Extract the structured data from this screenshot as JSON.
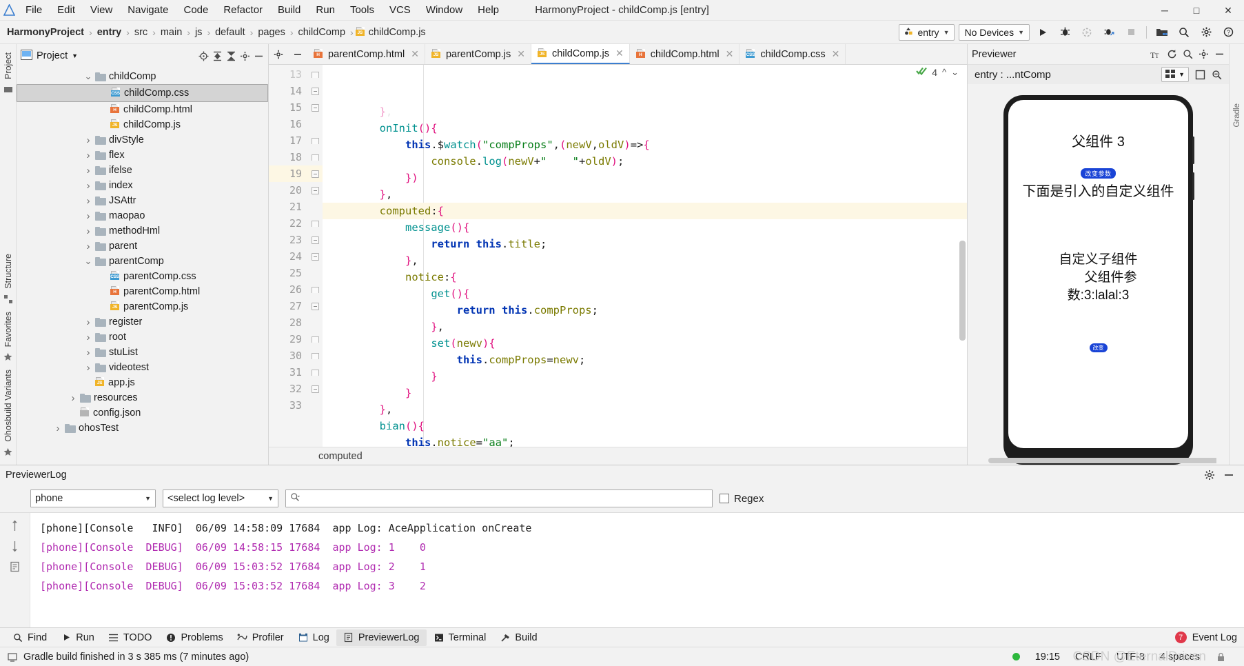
{
  "window": {
    "title": "HarmonyProject - childComp.js [entry]",
    "controls": {
      "minimize": "─",
      "maximize": "□",
      "close": "✕"
    }
  },
  "menubar": {
    "items": [
      "File",
      "Edit",
      "View",
      "Navigate",
      "Code",
      "Refactor",
      "Build",
      "Run",
      "Tools",
      "VCS",
      "Window",
      "Help"
    ]
  },
  "breadcrumb": {
    "items": [
      "HarmonyProject",
      "entry",
      "src",
      "main",
      "js",
      "default",
      "pages",
      "childComp",
      "childComp.js"
    ],
    "separator": "›"
  },
  "toolbar": {
    "run_config": "entry",
    "device": "No Devices",
    "icons": [
      "run-icon",
      "debug-icon",
      "run-coverage-icon",
      "attach-debugger-icon",
      "stop-icon",
      "project-structure-icon",
      "search-everywhere-icon",
      "settings-icon",
      "help-icon"
    ]
  },
  "project_panel": {
    "title": "Project",
    "header_icons": [
      "locate-file-icon",
      "expand-all-icon",
      "collapse-all-icon",
      "gear-icon",
      "hide-icon"
    ],
    "tree": [
      {
        "label": "childComp",
        "indent": 4,
        "type": "folder",
        "state": "open",
        "selected": false
      },
      {
        "label": "childComp.css",
        "indent": 5,
        "type": "css",
        "state": "none",
        "selected": true
      },
      {
        "label": "childComp.html",
        "indent": 5,
        "type": "html",
        "state": "none",
        "selected": false
      },
      {
        "label": "childComp.js",
        "indent": 5,
        "type": "js",
        "state": "none",
        "selected": false
      },
      {
        "label": "divStyle",
        "indent": 4,
        "type": "folder",
        "state": "closed",
        "selected": false
      },
      {
        "label": "flex",
        "indent": 4,
        "type": "folder",
        "state": "closed",
        "selected": false
      },
      {
        "label": "ifelse",
        "indent": 4,
        "type": "folder",
        "state": "closed",
        "selected": false
      },
      {
        "label": "index",
        "indent": 4,
        "type": "folder",
        "state": "closed",
        "selected": false
      },
      {
        "label": "JSAttr",
        "indent": 4,
        "type": "folder",
        "state": "closed",
        "selected": false
      },
      {
        "label": "maopao",
        "indent": 4,
        "type": "folder",
        "state": "closed",
        "selected": false
      },
      {
        "label": "methodHml",
        "indent": 4,
        "type": "folder",
        "state": "closed",
        "selected": false
      },
      {
        "label": "parent",
        "indent": 4,
        "type": "folder",
        "state": "closed",
        "selected": false
      },
      {
        "label": "parentComp",
        "indent": 4,
        "type": "folder",
        "state": "open",
        "selected": false
      },
      {
        "label": "parentComp.css",
        "indent": 5,
        "type": "css",
        "state": "none",
        "selected": false
      },
      {
        "label": "parentComp.html",
        "indent": 5,
        "type": "html",
        "state": "none",
        "selected": false
      },
      {
        "label": "parentComp.js",
        "indent": 5,
        "type": "js",
        "state": "none",
        "selected": false
      },
      {
        "label": "register",
        "indent": 4,
        "type": "folder",
        "state": "closed",
        "selected": false
      },
      {
        "label": "root",
        "indent": 4,
        "type": "folder",
        "state": "closed",
        "selected": false
      },
      {
        "label": "stuList",
        "indent": 4,
        "type": "folder",
        "state": "closed",
        "selected": false
      },
      {
        "label": "videotest",
        "indent": 4,
        "type": "folder",
        "state": "closed",
        "selected": false
      },
      {
        "label": "app.js",
        "indent": 4,
        "type": "js",
        "state": "none",
        "selected": false
      },
      {
        "label": "resources",
        "indent": 3,
        "type": "folder",
        "state": "closed",
        "selected": false
      },
      {
        "label": "config.json",
        "indent": 3,
        "type": "json",
        "state": "none",
        "selected": false
      },
      {
        "label": "ohosTest",
        "indent": 2,
        "type": "folder",
        "state": "closed",
        "selected": false
      }
    ]
  },
  "left_strip": {
    "labels": [
      "Project",
      "Structure",
      "Favorites",
      "Ohosbuild Variants"
    ]
  },
  "editor": {
    "tabs": [
      {
        "label": "parentComp.html",
        "type": "html",
        "active": false
      },
      {
        "label": "parentComp.js",
        "type": "js",
        "active": false
      },
      {
        "label": "childComp.js",
        "type": "js",
        "active": true
      },
      {
        "label": "childComp.html",
        "type": "html",
        "active": false
      },
      {
        "label": "childComp.css",
        "type": "css",
        "active": false
      }
    ],
    "inspection": {
      "count": "4",
      "up": "ⱏ",
      "down": "ⱟ"
    },
    "status_text": "computed",
    "lines": [
      {
        "n": "13",
        "text": "        },",
        "clipped": true
      },
      {
        "n": "14",
        "text": "        onInit(){"
      },
      {
        "n": "15",
        "text": "            this.$watch(\"compProps\",(newV,oldV)=>{"
      },
      {
        "n": "16",
        "text": "                console.log(newV+\"    \"+oldV);"
      },
      {
        "n": "17",
        "text": "            })"
      },
      {
        "n": "18",
        "text": "        },"
      },
      {
        "n": "19",
        "text": "        computed:{",
        "highlight": true
      },
      {
        "n": "20",
        "text": "            message(){"
      },
      {
        "n": "21",
        "text": "                return this.title;"
      },
      {
        "n": "22",
        "text": "            },"
      },
      {
        "n": "23",
        "text": "            notice:{"
      },
      {
        "n": "24",
        "text": "                get(){"
      },
      {
        "n": "25",
        "text": "                    return this.compProps;"
      },
      {
        "n": "26",
        "text": "                },"
      },
      {
        "n": "27",
        "text": "                set(newv){"
      },
      {
        "n": "28",
        "text": "                    this.compProps=newv;"
      },
      {
        "n": "29",
        "text": "                }"
      },
      {
        "n": "30",
        "text": "            }"
      },
      {
        "n": "31",
        "text": "        },"
      },
      {
        "n": "32",
        "text": "        bian(){"
      },
      {
        "n": "33",
        "text": "            this.notice=\"aa\";"
      }
    ]
  },
  "previewer": {
    "title": "Previewer",
    "header_icons": [
      "font-size-icon",
      "refresh-icon",
      "inspect-icon",
      "gear-icon",
      "hide-icon"
    ],
    "route": "entry : ...ntComp",
    "buttons": [
      "grid-icon",
      "chevron-down-icon",
      "rotate-icon",
      "zoom-out-icon"
    ],
    "phone": {
      "title": "父组件 3",
      "badge": "改变参数",
      "subtitle": "下面是引入的自定义组件",
      "child_lines": [
        "自定义子组件",
        "父组件参",
        "数:3:lalal:3"
      ],
      "badge2": "改变"
    }
  },
  "previewer_log": {
    "title": "PreviewerLog",
    "device_select": "phone",
    "level_select": "<select log level>",
    "search_placeholder": "",
    "regex_label": "Regex",
    "header_icons": [
      "gear-icon",
      "hide-icon"
    ],
    "side_icons": [
      "scroll-up-icon",
      "scroll-down-icon",
      "clipboard-icon"
    ],
    "entries": [
      {
        "prefix": "[phone][Console",
        "level": "   INFO]",
        "time": "06/09 14:58:09",
        "pid": "17684",
        "message": "app Log: AceApplication onCreate",
        "type": "info"
      },
      {
        "prefix": "[phone][Console",
        "level": "  DEBUG]",
        "time": "06/09 14:58:15",
        "pid": "17684",
        "message": "app Log: 1    0",
        "type": "debug"
      },
      {
        "prefix": "[phone][Console",
        "level": "  DEBUG]",
        "time": "06/09 15:03:52",
        "pid": "17684",
        "message": "app Log: 2    1",
        "type": "debug"
      },
      {
        "prefix": "[phone][Console",
        "level": "  DEBUG]",
        "time": "06/09 15:03:52",
        "pid": "17684",
        "message": "app Log: 3    2",
        "type": "debug"
      }
    ]
  },
  "toolwindow_bar": {
    "items": [
      {
        "label": "Find",
        "icon": "search-icon",
        "active": false
      },
      {
        "label": "Run",
        "icon": "play-icon",
        "active": false
      },
      {
        "label": "TODO",
        "icon": "list-icon",
        "active": false
      },
      {
        "label": "Problems",
        "icon": "warning-icon",
        "active": false
      },
      {
        "label": "Profiler",
        "icon": "profiler-icon",
        "active": false
      },
      {
        "label": "Log",
        "icon": "log-icon",
        "active": false
      },
      {
        "label": "PreviewerLog",
        "icon": "previewerlog-icon",
        "active": true
      },
      {
        "label": "Terminal",
        "icon": "terminal-icon",
        "active": false
      },
      {
        "label": "Build",
        "icon": "hammer-icon",
        "active": false
      }
    ],
    "event_log": {
      "label": "Event Log",
      "badge": "7"
    }
  },
  "statusbar": {
    "message": "Gradle build finished in 3 s 385 ms (7 minutes ago)",
    "time": "19:15",
    "line_separator": "CRLF",
    "encoding": "UTF-8",
    "indent": "4 spaces",
    "watermark": "CSDN @EternalDriven"
  },
  "colors": {
    "accent": "#3c7fd0",
    "badge_blue": "#1a44d6",
    "error_red": "#e0384a",
    "ok_green": "#2db83d",
    "highlight_line": "#fdf7e4"
  }
}
